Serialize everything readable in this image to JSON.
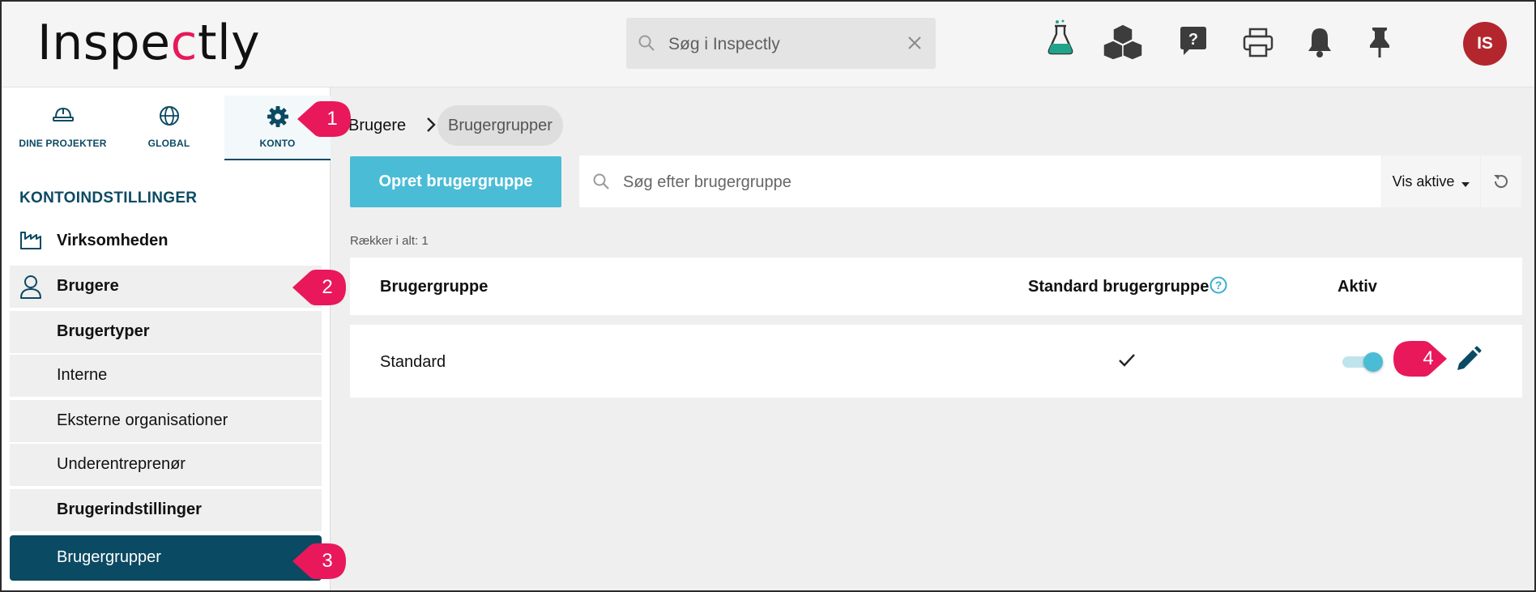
{
  "header": {
    "logo": {
      "pre": "Inspe",
      "mark": "c",
      "post": "tly"
    },
    "search_placeholder": "Søg i Inspectly",
    "icons": [
      "flask-icon",
      "cubes-icon",
      "help-chat-icon",
      "print-icon",
      "bell-icon",
      "pin-icon"
    ],
    "avatar_initials": "IS"
  },
  "sidebar": {
    "tabs": [
      {
        "label": "DINE PROJEKTER",
        "icon": "hardhat-icon"
      },
      {
        "label": "GLOBAL",
        "icon": "globe-icon"
      },
      {
        "label": "KONTO",
        "icon": "gear-icon",
        "active": true
      }
    ],
    "section_title": "KONTOINDSTILLINGER",
    "items": [
      {
        "label": "Virksomheden",
        "icon": "factory-icon"
      },
      {
        "label": "Brugere",
        "icon": "user-icon"
      },
      {
        "label": "Brugertyper"
      },
      {
        "label": "Interne"
      },
      {
        "label": "Eksterne organisationer"
      },
      {
        "label": "Underentreprenør"
      },
      {
        "label": "Brugerindstillinger"
      },
      {
        "label": "Brugergrupper",
        "active": true
      }
    ]
  },
  "main": {
    "breadcrumb": [
      "Brugere",
      "Brugergrupper"
    ],
    "create_button": "Opret brugergruppe",
    "search_placeholder": "Søg efter brugergruppe",
    "filter_label": "Vis aktive",
    "rows_count": "Rækker i alt: 1",
    "columns": [
      "Brugergruppe",
      "Standard brugergruppe",
      "Aktiv"
    ],
    "rows": [
      {
        "name": "Standard",
        "is_default": true,
        "active": true
      }
    ]
  },
  "callouts": [
    "1",
    "2",
    "3",
    "4"
  ],
  "colors": {
    "brand_dark": "#0b4a63",
    "accent": "#4abcd6",
    "logo_mark": "#e8185a",
    "callout": "#e8185a",
    "avatar": "#b3262d"
  }
}
